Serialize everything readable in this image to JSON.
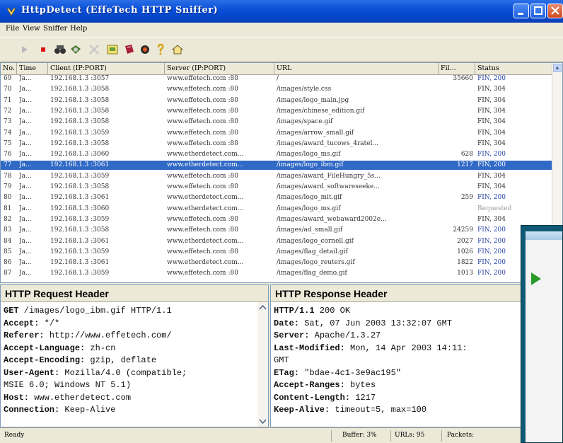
{
  "window": {
    "title": "HttpDetect (EffeTech HTTP Sniffer)"
  },
  "menu": [
    "File",
    "View",
    "Sniffer",
    "Help"
  ],
  "toolbar_icons": [
    "start-icon",
    "stop-icon",
    "binoculars-icon",
    "filter-icon",
    "clear-icon",
    "export-icon",
    "save-icon",
    "settings-icon",
    "help-icon",
    "home-icon"
  ],
  "columns": [
    "No.",
    "Time",
    "Client (IP:PORT)",
    "Server (IP:PORT)",
    "URL",
    "Fil...",
    "Status"
  ],
  "rows": [
    {
      "no": "69",
      "time": "Ja...",
      "client": "192.168.1.3 :3057",
      "server": "www.effetech.com :80",
      "url": "/",
      "size": "35660",
      "status": "FIN, 200",
      "s": "200"
    },
    {
      "no": "70",
      "time": "Ja...",
      "client": "192.168.1.3 :3058",
      "server": "www.effetech.com :80",
      "url": "/images/style.css",
      "size": "",
      "status": "FIN, 304",
      "s": "304"
    },
    {
      "no": "71",
      "time": "Ja...",
      "client": "192.168.1.3 :3058",
      "server": "www.effetech.com :80",
      "url": "/images/logo_main.jpg",
      "size": "",
      "status": "FIN, 304",
      "s": "304"
    },
    {
      "no": "72",
      "time": "Ja...",
      "client": "192.168.1.3 :3058",
      "server": "www.effetech.com :80",
      "url": "/images/chinese_edition.gif",
      "size": "",
      "status": "FIN, 304",
      "s": "304"
    },
    {
      "no": "73",
      "time": "Ja...",
      "client": "192.168.1.3 :3058",
      "server": "www.effetech.com :80",
      "url": "/images/space.gif",
      "size": "",
      "status": "FIN, 304",
      "s": "304"
    },
    {
      "no": "74",
      "time": "Ja...",
      "client": "192.168.1.3 :3059",
      "server": "www.effetech.com :80",
      "url": "/images/arrow_small.gif",
      "size": "",
      "status": "FIN, 304",
      "s": "304"
    },
    {
      "no": "75",
      "time": "Ja...",
      "client": "192.168.1.3 :3058",
      "server": "www.effetech.com :80",
      "url": "/images/award_tucows_4ratel...",
      "size": "",
      "status": "FIN, 304",
      "s": "304"
    },
    {
      "no": "76",
      "time": "Ja...",
      "client": "192.168.1.3 :3060",
      "server": "www.etherdetect.com...",
      "url": "/images/logo_ms.gif",
      "size": "628",
      "status": "FIN, 200",
      "s": "200"
    },
    {
      "no": "77",
      "time": "Ja...",
      "client": "192.168.1.3 :3061",
      "server": "www.etherdetect.com...",
      "url": "/images/logo_ibm.gif",
      "size": "1217",
      "status": "FIN, 200",
      "s": "200",
      "selected": true
    },
    {
      "no": "78",
      "time": "Ja...",
      "client": "192.168.1.3 :3059",
      "server": "www.effetech.com :80",
      "url": "/images/award_FileHungry_5s...",
      "size": "",
      "status": "FIN, 304",
      "s": "304"
    },
    {
      "no": "79",
      "time": "Ja...",
      "client": "192.168.1.3 :3058",
      "server": "www.effetech.com :80",
      "url": "/images/award_softwareseeke...",
      "size": "",
      "status": "FIN, 304",
      "s": "304"
    },
    {
      "no": "80",
      "time": "Ja...",
      "client": "192.168.1.3 :3061",
      "server": "www.etherdetect.com...",
      "url": "/images/logo_mit.gif",
      "size": "259",
      "status": "FIN, 200",
      "s": "200"
    },
    {
      "no": "81",
      "time": "Ja...",
      "client": "192.168.1.3 :3060",
      "server": "www.etherdetect.com...",
      "url": "/images/logo_ms.gif",
      "size": "",
      "status": "Requested",
      "s": "req"
    },
    {
      "no": "82",
      "time": "Ja...",
      "client": "192.168.1.3 :3059",
      "server": "www.effetech.com :80",
      "url": "/images/award_webaward2002e...",
      "size": "",
      "status": "FIN, 304",
      "s": "304"
    },
    {
      "no": "83",
      "time": "Ja...",
      "client": "192.168.1.3 :3058",
      "server": "www.effetech.com :80",
      "url": "/images/ad_small.gif",
      "size": "24259",
      "status": "FIN, 200",
      "s": "200"
    },
    {
      "no": "84",
      "time": "Ja...",
      "client": "192.168.1.3 :3061",
      "server": "www.etherdetect.com...",
      "url": "/images/logo_cornell.gif",
      "size": "2027",
      "status": "FIN, 200",
      "s": "200"
    },
    {
      "no": "85",
      "time": "Ja...",
      "client": "192.168.1.3 :3059",
      "server": "www.effetech.com :80",
      "url": "/images/flag_detail.gif",
      "size": "1026",
      "status": "FIN, 200",
      "s": "200"
    },
    {
      "no": "86",
      "time": "Ja...",
      "client": "192.168.1.3 :3061",
      "server": "www.etherdetect.com...",
      "url": "/images/logo_reuters.gif",
      "size": "1822",
      "status": "FIN, 200",
      "s": "200"
    },
    {
      "no": "87",
      "time": "Ja...",
      "client": "192.168.1.3 :3059",
      "server": "www.effetech.com :80",
      "url": "/images/flag_demo.gif",
      "size": "1013",
      "status": "FIN, 200",
      "s": "200"
    }
  ],
  "request_pane": {
    "title": "HTTP Request Header",
    "lines": [
      {
        "key": "GET",
        "val": " /images/logo_ibm.gif HTTP/1.1"
      },
      {
        "key": "Accept:",
        "val": " */*"
      },
      {
        "key": "Referer:",
        "val": " http://www.effetech.com/"
      },
      {
        "key": "Accept-Language:",
        "val": " zh-cn"
      },
      {
        "key": "Accept-Encoding:",
        "val": " gzip, deflate"
      },
      {
        "key": "User-Agent:",
        "val": " Mozilla/4.0 (compatible;"
      },
      {
        "key": "",
        "val": "MSIE 6.0; Windows NT 5.1)"
      },
      {
        "key": "Host:",
        "val": " www.etherdetect.com"
      },
      {
        "key": "Connection:",
        "val": " Keep-Alive"
      }
    ]
  },
  "response_pane": {
    "title": "HTTP Response Header",
    "lines": [
      {
        "key": "HTTP/1.1",
        "val": " 200 OK"
      },
      {
        "key": "Date:",
        "val": " Sat, 07 Jun 2003 13:32:07 GMT"
      },
      {
        "key": "Server:",
        "val": " Apache/1.3.27"
      },
      {
        "key": "Last-Modified:",
        "val": " Mon, 14 Apr 2003 14:11:"
      },
      {
        "key": "",
        "val": "GMT"
      },
      {
        "key": "ETag:",
        "val": " \"bdae-4c1-3e9ac195\""
      },
      {
        "key": "Accept-Ranges:",
        "val": " bytes"
      },
      {
        "key": "Content-Length:",
        "val": " 1217"
      },
      {
        "key": "Keep-Alive:",
        "val": " timeout=5, max=100"
      }
    ]
  },
  "statusbar": {
    "ready": "Ready",
    "buffer": "Buffer: 3%",
    "urls": "URLs: 95",
    "packets": "Packets:"
  },
  "colors": {
    "title_blue": "#0a50d8",
    "selection": "#3169c6",
    "status_200": "#2b46a6"
  }
}
